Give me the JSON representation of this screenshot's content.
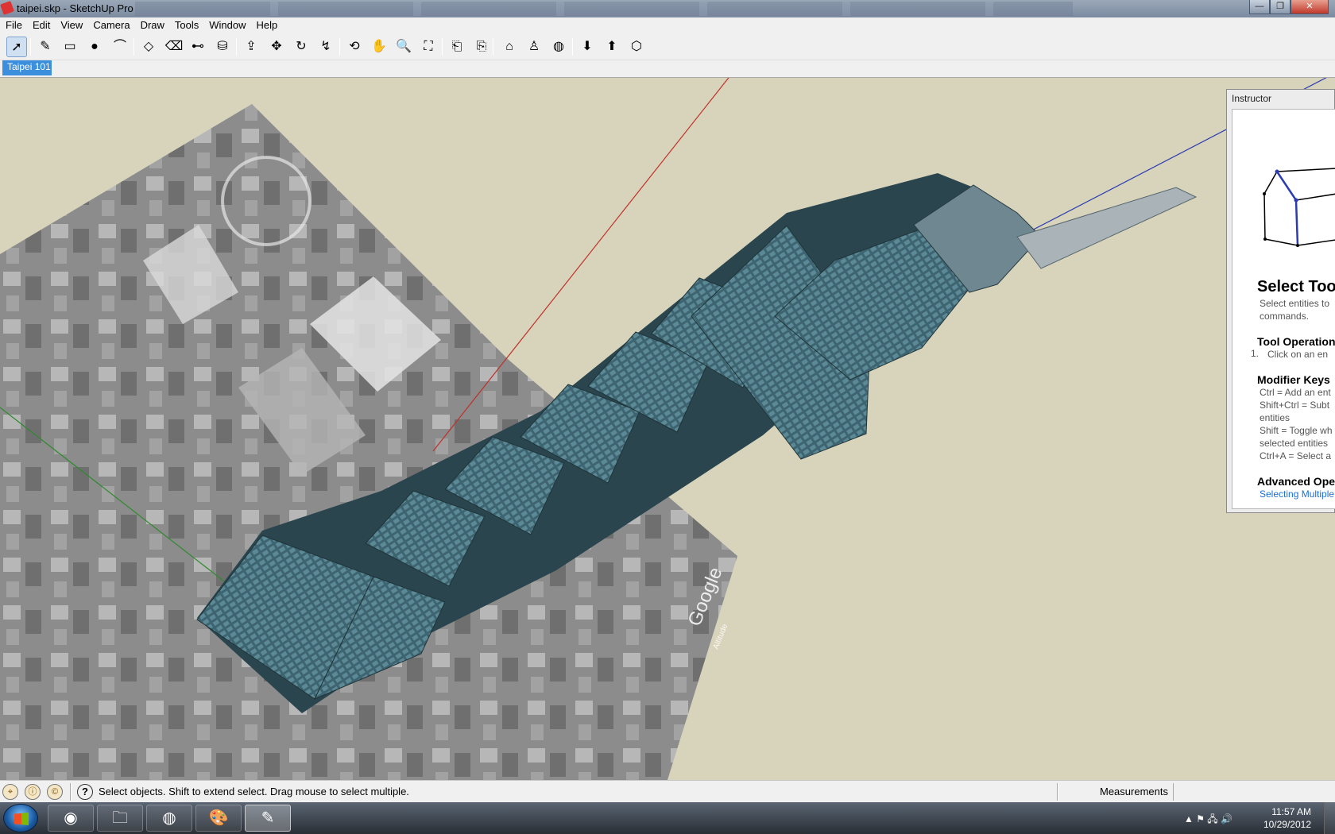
{
  "window": {
    "title": "taipei.skp - SketchUp Pro",
    "min_glyph": "—",
    "max_glyph": "❐",
    "close_glyph": "✕"
  },
  "menu": [
    "File",
    "Edit",
    "View",
    "Camera",
    "Draw",
    "Tools",
    "Window",
    "Help"
  ],
  "toolbar": {
    "tools": [
      {
        "name": "select-tool",
        "glyph": "➚",
        "active": true
      },
      {
        "name": "pencil-tool",
        "glyph": "✎"
      },
      {
        "name": "rectangle-tool",
        "glyph": "▭"
      },
      {
        "name": "circle-tool",
        "glyph": "●"
      },
      {
        "name": "arc-tool",
        "glyph": "⌒"
      },
      {
        "name": "make-component-tool",
        "glyph": "◇"
      },
      {
        "name": "eraser-tool",
        "glyph": "⌫"
      },
      {
        "name": "tape-measure-tool",
        "glyph": "⊷"
      },
      {
        "name": "paint-bucket-tool",
        "glyph": "⛁"
      },
      {
        "name": "push-pull-tool",
        "glyph": "⇪"
      },
      {
        "name": "move-tool",
        "glyph": "✥"
      },
      {
        "name": "rotate-tool",
        "glyph": "↻"
      },
      {
        "name": "follow-me-tool",
        "glyph": "↯"
      },
      {
        "name": "orbit-tool",
        "glyph": "⟲"
      },
      {
        "name": "pan-tool",
        "glyph": "✋"
      },
      {
        "name": "zoom-tool",
        "glyph": "🔍"
      },
      {
        "name": "zoom-extents-tool",
        "glyph": "⛶"
      },
      {
        "name": "previous-view-tool",
        "glyph": "⎗"
      },
      {
        "name": "next-view-tool",
        "glyph": "⎘"
      },
      {
        "name": "add-location-tool",
        "glyph": "⌂"
      },
      {
        "name": "position-camera-tool",
        "glyph": "♙"
      },
      {
        "name": "google-earth-tool",
        "glyph": "◍"
      },
      {
        "name": "get-models-tool",
        "glyph": "⬇"
      },
      {
        "name": "share-model-tool",
        "glyph": "⬆"
      },
      {
        "name": "share-component-tool",
        "glyph": "⬡"
      }
    ]
  },
  "scene_tab": "Taipei 101",
  "viewport": {
    "ground_label": "Google",
    "altitude_label": "Altitude",
    "colors": {
      "sky": "#d8d4bc",
      "tower": "#2e4c55",
      "tower_face": "#3c5f6a",
      "red_axis": "#c0302a",
      "green_axis": "#2f8a2f",
      "blue_axis": "#2a3cb0"
    }
  },
  "instructor": {
    "panel_title": "Instructor",
    "heading": "Select Tool",
    "desc_1": "Select entities to",
    "desc_2": "commands.",
    "tool_operation": "Tool Operation",
    "op_num": "1.",
    "op_text": "Click on an en",
    "modifier_keys": "Modifier Keys",
    "mod_1": "Ctrl = Add an ent",
    "mod_2": "Shift+Ctrl = Subt",
    "mod_3": "entities",
    "mod_4": "Shift = Toggle wh",
    "mod_5": "selected entities",
    "mod_6": "Ctrl+A = Select a",
    "advanced": "Advanced Ope",
    "link": "Selecting Multiple"
  },
  "status": {
    "message": "Select objects. Shift to extend select. Drag mouse to select multiple.",
    "measurements_label": "Measurements",
    "help_glyph": "?",
    "geo_icons": [
      "⌖",
      "ⓘ",
      "©"
    ]
  },
  "taskbar": {
    "apps": [
      {
        "name": "chrome-taskbar-button",
        "glyph": "◉"
      },
      {
        "name": "explorer-taskbar-button",
        "glyph": "🗀"
      },
      {
        "name": "google-earth-taskbar-button",
        "glyph": "◍"
      },
      {
        "name": "paint-taskbar-button",
        "glyph": "🎨"
      },
      {
        "name": "sketchup-taskbar-button",
        "glyph": "✎",
        "active": true
      }
    ],
    "tray_icons": "▲  ⚑  🖧  🔊",
    "time": "11:57 AM",
    "date": "10/29/2012"
  }
}
